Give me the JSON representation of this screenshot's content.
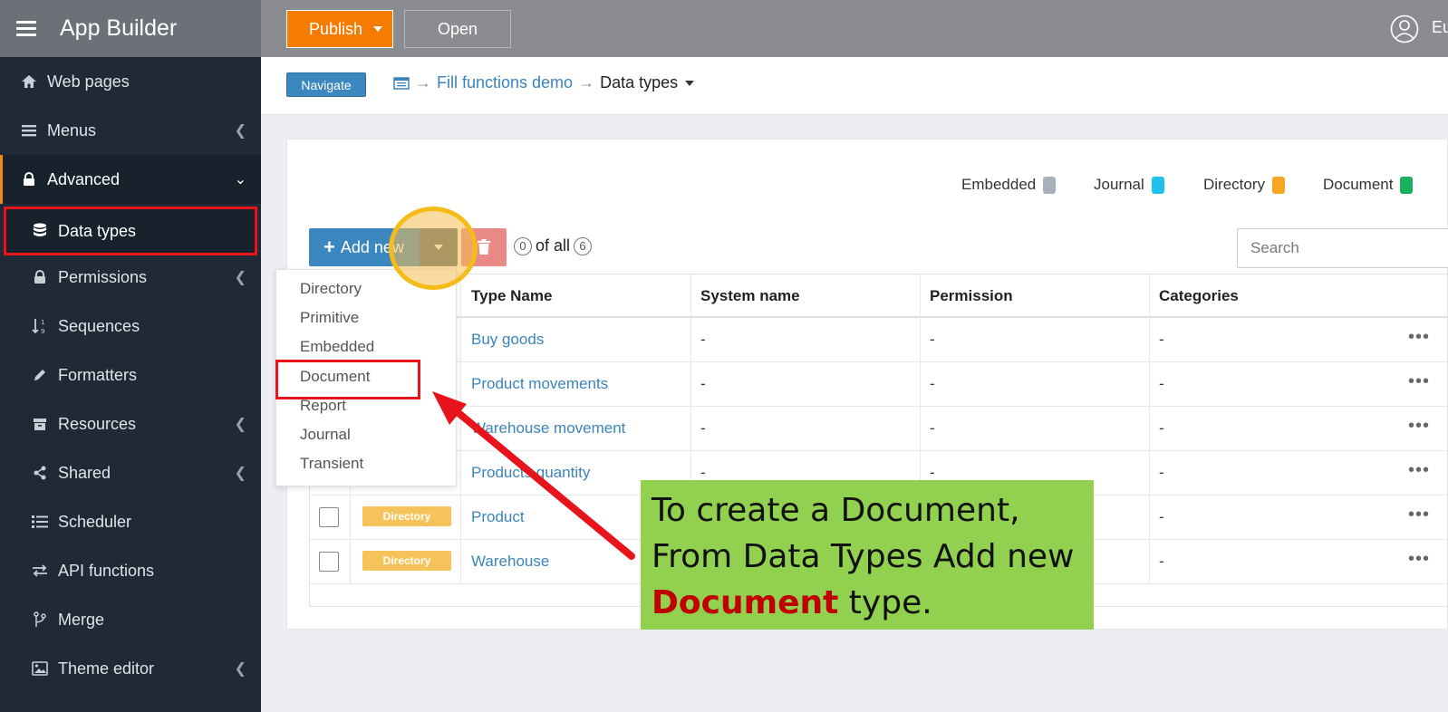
{
  "app": {
    "title": "App Builder",
    "user_name": "Eu"
  },
  "sidebar": {
    "items": [
      {
        "label": "Web pages",
        "icon": "home-icon"
      },
      {
        "label": "Menus",
        "icon": "list-icon"
      },
      {
        "label": "Advanced",
        "icon": "lock-icon"
      },
      {
        "label": "Data types",
        "icon": "database-icon"
      },
      {
        "label": "Permissions",
        "icon": "lock-icon"
      },
      {
        "label": "Sequences",
        "icon": "sort-numeric-icon"
      },
      {
        "label": "Formatters",
        "icon": "pencil-icon"
      },
      {
        "label": "Resources",
        "icon": "archive-icon"
      },
      {
        "label": "Shared",
        "icon": "share-icon"
      },
      {
        "label": "Scheduler",
        "icon": "list-numbered-icon"
      },
      {
        "label": "API functions",
        "icon": "exchange-icon"
      },
      {
        "label": "Merge",
        "icon": "merge-icon"
      },
      {
        "label": "Theme editor",
        "icon": "image-icon"
      }
    ]
  },
  "toolbar": {
    "publish_label": "Publish",
    "open_label": "Open"
  },
  "breadcrumb": {
    "navigate_label": "Navigate",
    "project": "Fill functions demo",
    "current": "Data types"
  },
  "legend": [
    {
      "label": "Embedded",
      "color": "#a7b0bb"
    },
    {
      "label": "Journal",
      "color": "#1ec1ee"
    },
    {
      "label": "Directory",
      "color": "#f5a623"
    },
    {
      "label": "Document",
      "color": "#19b15c"
    }
  ],
  "actions": {
    "add_new_label": "Add new",
    "selected_count": "0",
    "of_all_label": "of all",
    "total_count": "6",
    "search_placeholder": "Search"
  },
  "dropdown": {
    "items": [
      "Directory",
      "Primitive",
      "Embedded",
      "Document",
      "Report",
      "Journal",
      "Transient"
    ]
  },
  "table": {
    "columns": [
      "Type Name",
      "System name",
      "Permission",
      "Categories"
    ],
    "rows": [
      {
        "kind": "",
        "name": "Buy goods",
        "system": "-",
        "permission": "-",
        "categories": "-"
      },
      {
        "kind": "",
        "name": "Product movements",
        "system": "-",
        "permission": "-",
        "categories": "-"
      },
      {
        "kind": "",
        "name": "Warehouse movement",
        "system": "-",
        "permission": "-",
        "categories": "-"
      },
      {
        "kind": "",
        "name": "Products quantity",
        "system": "-",
        "permission": "-",
        "categories": "-"
      },
      {
        "kind": "Directory",
        "name": "Product",
        "system": "-",
        "permission": "-",
        "categories": "-"
      },
      {
        "kind": "Directory",
        "name": "Warehouse",
        "system": "-",
        "permission": "-",
        "categories": "-"
      }
    ],
    "more_label": "•••"
  },
  "annotation": {
    "line1": "To create a Document,",
    "line2": "From Data Types Add new",
    "line3_emphasis": "Document",
    "line3_rest": " type."
  },
  "colors": {
    "accent": "#f57c00",
    "primary": "#3d87c0",
    "sidebar": "#1f2a36",
    "highlight": "#e8141b",
    "callout": "#92d050"
  }
}
